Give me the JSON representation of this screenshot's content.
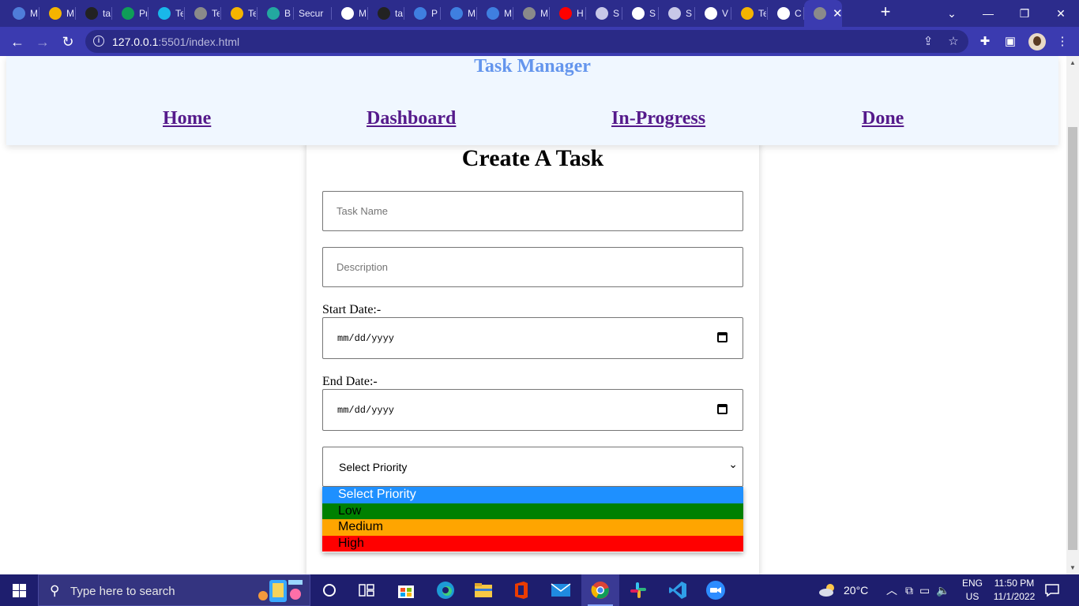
{
  "browser": {
    "tabs": [
      {
        "title": "M",
        "icon": "mail-icon",
        "color": "#4f7dd9"
      },
      {
        "title": "M",
        "icon": "google-drive-icon",
        "color": "#f4b400"
      },
      {
        "title": "ta",
        "icon": "github-icon",
        "color": "#222222"
      },
      {
        "title": "Pr",
        "icon": "sheets-icon",
        "color": "#0f9d58"
      },
      {
        "title": "Te",
        "icon": "vimeo-icon",
        "color": "#19b7ea"
      },
      {
        "title": "Te",
        "icon": "globe-icon",
        "color": "#8a8a8a"
      },
      {
        "title": "Te",
        "icon": "google-drive-icon",
        "color": "#f4b400"
      },
      {
        "title": "B",
        "icon": "diamond-icon",
        "color": "#23a8a0"
      },
      {
        "title": "Secur",
        "icon": "",
        "color": ""
      },
      {
        "title": "M",
        "icon": "google-icon",
        "color": "#ffffff"
      },
      {
        "title": "ta",
        "icon": "github-icon",
        "color": "#222222"
      },
      {
        "title": "P",
        "icon": "canva-icon",
        "color": "#3f7fe0"
      },
      {
        "title": "M",
        "icon": "canva-icon",
        "color": "#3f7fe0"
      },
      {
        "title": "M",
        "icon": "canva-icon",
        "color": "#3f7fe0"
      },
      {
        "title": "M",
        "icon": "globe-icon",
        "color": "#8a8a8a"
      },
      {
        "title": "H",
        "icon": "youtube-icon",
        "color": "#ff0000"
      },
      {
        "title": "S",
        "icon": "store-icon",
        "color": "#c8c8e8"
      },
      {
        "title": "S",
        "icon": "google-icon",
        "color": "#ffffff"
      },
      {
        "title": "S",
        "icon": "store-icon",
        "color": "#c8c8e8"
      },
      {
        "title": "V",
        "icon": "google-icon",
        "color": "#ffffff"
      },
      {
        "title": "Te",
        "icon": "google-drive-icon",
        "color": "#f4b400"
      },
      {
        "title": "C",
        "icon": "google-icon",
        "color": "#ffffff"
      },
      {
        "title": "",
        "icon": "globe-icon",
        "color": "#8a8a8a",
        "active": true
      }
    ],
    "new_tab": "+",
    "window_controls": {
      "minimize": "—",
      "restore": "❐",
      "close": "✕",
      "tab_search": "⌄"
    },
    "url_host": "127.0.0.1",
    "url_rest": ":5501/index.html"
  },
  "page": {
    "brand": "Task Manager",
    "nav": [
      {
        "label": "Home"
      },
      {
        "label": "Dashboard"
      },
      {
        "label": "In-Progress"
      },
      {
        "label": "Done"
      }
    ],
    "form": {
      "title": "Create A Task",
      "task_name_placeholder": "Task Name",
      "description_placeholder": "Description",
      "start_label": "Start Date:-",
      "end_label": "End Date:-",
      "date_placeholder": "mm/dd/yyyy",
      "priority_selected": "Select Priority",
      "priority_options": [
        {
          "label": "Select Priority",
          "bg": "#1e90ff",
          "fg": "#ffffff"
        },
        {
          "label": "Low",
          "bg": "#008000",
          "fg": "#000000"
        },
        {
          "label": "Medium",
          "bg": "#ffa500",
          "fg": "#000000"
        },
        {
          "label": "High",
          "bg": "#ff0000",
          "fg": "#000000"
        }
      ]
    }
  },
  "taskbar": {
    "search_placeholder": "Type here to search",
    "weather": "20°C",
    "lang_top": "ENG",
    "lang_bottom": "US",
    "time": "11:50 PM",
    "date": "11/1/2022"
  }
}
